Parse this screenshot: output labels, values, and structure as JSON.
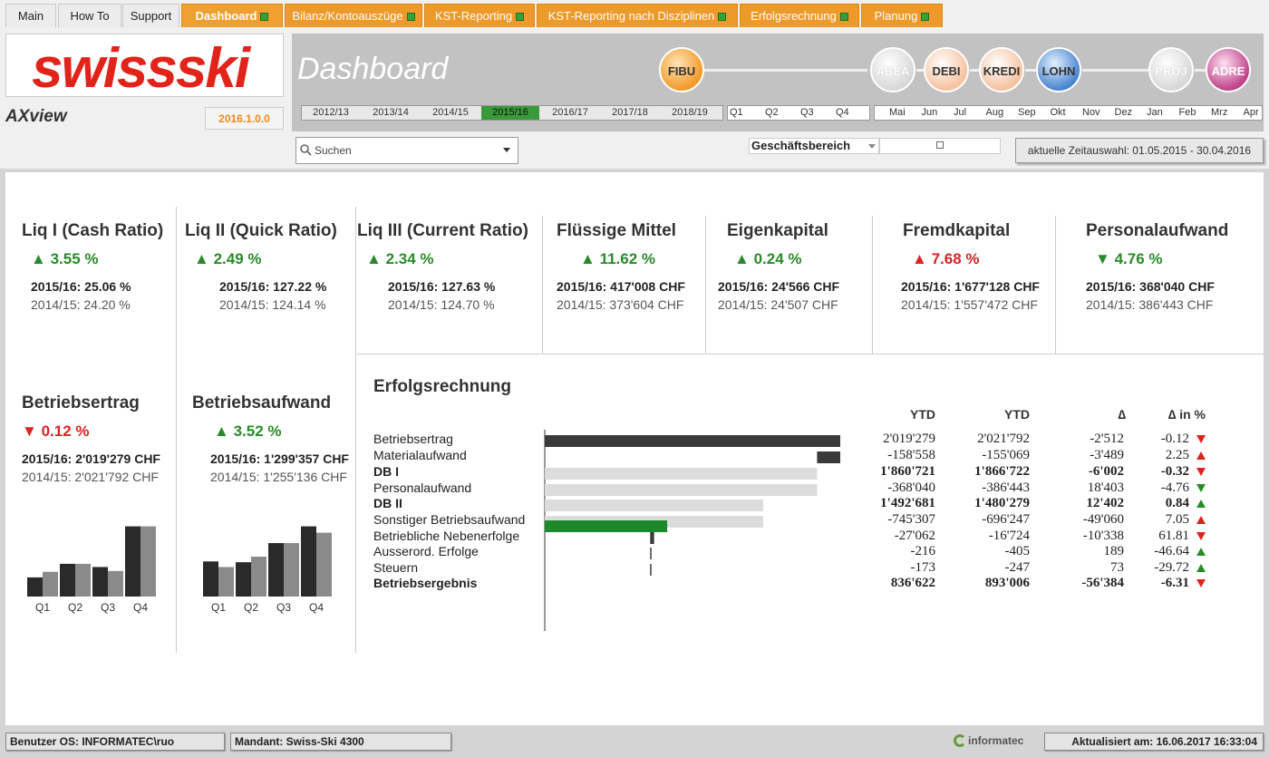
{
  "tabs": [
    {
      "label": "Main",
      "style": "plain",
      "x": 0
    },
    {
      "label": "How To",
      "style": "plain"
    },
    {
      "label": "Support",
      "style": "plain"
    },
    {
      "label": "Dashboard",
      "style": "active"
    },
    {
      "label": "Bilanz/Kontoauszüge",
      "style": "orange"
    },
    {
      "label": "KST-Reporting",
      "style": "orange"
    },
    {
      "label": "KST-Reporting nach Disziplinen",
      "style": "orange"
    },
    {
      "label": "Erfolgsrechnung",
      "style": "orange"
    },
    {
      "label": "Planung",
      "style": "orange"
    }
  ],
  "header": {
    "logo_text": "swissski",
    "axview_prefix": "AX",
    "axview_suffix": "view",
    "version": "2016.1.0.0",
    "dashboard_title": "Dashboard"
  },
  "modules": [
    "FIBU",
    "ABEA",
    "DEBI",
    "KREDI",
    "LOHN",
    "PROJ",
    "ADRE"
  ],
  "years": [
    "2012/13",
    "2013/14",
    "2014/15",
    "2015/16",
    "2016/17",
    "2017/18",
    "2018/19"
  ],
  "selected_year": "2015/16",
  "quarters": [
    "Q1",
    "Q2",
    "Q3",
    "Q4"
  ],
  "months": [
    "Mai",
    "Jun",
    "Jul",
    "Aug",
    "Sep",
    "Okt",
    "Nov",
    "Dez",
    "Jan",
    "Feb",
    "Mrz",
    "Apr"
  ],
  "search": {
    "placeholder": "Suchen"
  },
  "geschaeftsbereich": {
    "label": "Geschäftsbereich"
  },
  "zeitauswahl": "aktuelle Zeitauswahl: 01.05.2015 - 30.04.2016",
  "kpis": [
    {
      "title": "Liq I (Cash Ratio)",
      "pct": "3.55 %",
      "dir": "up",
      "color": "green",
      "cur": "2015/16: 25.06 %",
      "prev": "2014/15: 24.20 %"
    },
    {
      "title": "Liq II (Quick Ratio)",
      "pct": "2.49 %",
      "dir": "up",
      "color": "green",
      "cur": "2015/16: 127.22 %",
      "prev": "2014/15: 124.14 %"
    },
    {
      "title": "Liq III (Current Ratio)",
      "pct": "2.34 %",
      "dir": "up",
      "color": "green",
      "cur": "2015/16: 127.63 %",
      "prev": "2014/15: 124.70 %"
    },
    {
      "title": "Flüssige Mittel",
      "pct": "11.62 %",
      "dir": "up",
      "color": "green",
      "cur": "2015/16: 417'008 CHF",
      "prev": "2014/15: 373'604 CHF"
    },
    {
      "title": "Eigenkapital",
      "pct": "0.24 %",
      "dir": "up",
      "color": "green",
      "cur": "2015/16: 24'566 CHF",
      "prev": "2014/15: 24'507 CHF"
    },
    {
      "title": "Fremdkapital",
      "pct": "7.68 %",
      "dir": "up",
      "color": "red",
      "cur": "2015/16: 1'677'128 CHF",
      "prev": "2014/15: 1'557'472 CHF"
    },
    {
      "title": "Personalaufwand",
      "pct": "4.76 %",
      "dir": "down",
      "color": "green",
      "cur": "2015/16: 368'040 CHF",
      "prev": "2014/15: 386'443 CHF"
    }
  ],
  "kpis2": [
    {
      "title": "Betriebsertrag",
      "pct": "0.12 %",
      "dir": "down",
      "color": "red",
      "cur": "2015/16: 2'019'279 CHF",
      "prev": "2014/15: 2'021'792 CHF"
    },
    {
      "title": "Betriebsaufwand",
      "pct": "3.52 %",
      "dir": "up",
      "color": "green",
      "cur": "2015/16: 1'299'357 CHF",
      "prev": "2014/15: 1'255'136 CHF"
    }
  ],
  "chart_data": [
    {
      "type": "bar",
      "categories": [
        "Q1",
        "Q2",
        "Q3",
        "Q4"
      ],
      "series": [
        {
          "values": [
            24,
            41,
            37,
            88
          ]
        },
        {
          "values": [
            31,
            41,
            32,
            88
          ]
        }
      ]
    },
    {
      "type": "bar",
      "categories": [
        "Q1",
        "Q2",
        "Q3",
        "Q4"
      ],
      "series": [
        {
          "values": [
            44,
            43,
            67,
            88
          ]
        },
        {
          "values": [
            37,
            50,
            67,
            80
          ]
        }
      ]
    }
  ],
  "erfolgsrechnung": {
    "title": "Erfolgsrechnung",
    "headers": [
      "YTD",
      "YTD",
      "∆",
      "∆ in %"
    ],
    "rows": [
      {
        "label": "Betriebsertrag",
        "ytd": "2'019'279",
        "ytd_prev": "2'021'792",
        "delta": "-2'512",
        "delta_pct": "-0.12",
        "trend": "down-red",
        "bold": false,
        "bar": 2019279
      },
      {
        "label": "Materialaufwand",
        "ytd": "-158'558",
        "ytd_prev": "-155'069",
        "delta": "-3'489",
        "delta_pct": "2.25",
        "trend": "up-red",
        "bold": false,
        "bar": -158558
      },
      {
        "label": "DB I",
        "ytd": "1'860'721",
        "ytd_prev": "1'866'722",
        "delta": "-6'002",
        "delta_pct": "-0.32",
        "trend": "down-red",
        "bold": true,
        "bar": 1860721
      },
      {
        "label": "Personalaufwand",
        "ytd": "-368'040",
        "ytd_prev": "-386'443",
        "delta": "18'403",
        "delta_pct": "-4.76",
        "trend": "down-green",
        "bold": false,
        "bar": -368040
      },
      {
        "label": "DB II",
        "ytd": "1'492'681",
        "ytd_prev": "1'480'279",
        "delta": "12'402",
        "delta_pct": "0.84",
        "trend": "up-green",
        "bold": true,
        "bar": 1492681
      },
      {
        "label": "Sonstiger Betriebsaufwand",
        "ytd": "-745'307",
        "ytd_prev": "-696'247",
        "delta": "-49'060",
        "delta_pct": "7.05",
        "trend": "up-red",
        "bold": false,
        "bar": -745307
      },
      {
        "label": "Betriebliche Nebenerfolge",
        "ytd": "-27'062",
        "ytd_prev": "-16'724",
        "delta": "-10'338",
        "delta_pct": "61.81",
        "trend": "down-red",
        "bold": false,
        "bar": -27062
      },
      {
        "label": "Ausserord. Erfolge",
        "ytd": "-216",
        "ytd_prev": "-405",
        "delta": "189",
        "delta_pct": "-46.64",
        "trend": "up-green",
        "bold": false,
        "bar": -216
      },
      {
        "label": "Steuern",
        "ytd": "-173",
        "ytd_prev": "-247",
        "delta": "73",
        "delta_pct": "-29.72",
        "trend": "up-green",
        "bold": false,
        "bar": -173
      },
      {
        "label": "Betriebsergebnis",
        "ytd": "836'622",
        "ytd_prev": "893'006",
        "delta": "-56'384",
        "delta_pct": "-6.31",
        "trend": "down-red",
        "bold": true,
        "bar": 836622
      }
    ]
  },
  "footer": {
    "user": "Benutzer OS: INFORMATEC\\ruo",
    "mandant": "Mandant: Swiss-Ski 4300",
    "brand": "informatec",
    "updated": "Aktualisiert am: 16.06.2017 16:33:04"
  },
  "colors": {
    "orange": "#ee9a2a",
    "green": "#2a8a2a",
    "red": "#d22",
    "bar_dark": "#3a3a3a",
    "bar_light": "#dcdcdc",
    "bar_green": "#1a8a2a"
  }
}
